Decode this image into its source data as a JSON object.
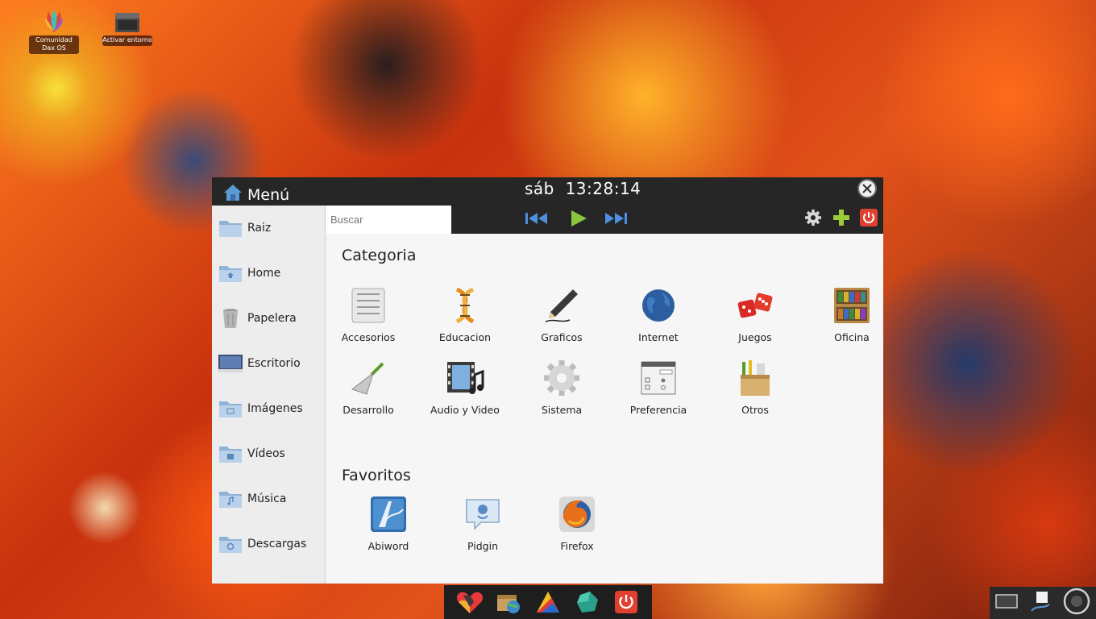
{
  "desktop": {
    "icons": [
      {
        "label": "Comunidad Dax OS",
        "icon": "dax-os-logo-icon"
      },
      {
        "label": "Activar entorno",
        "icon": "terminal-icon"
      }
    ]
  },
  "menu": {
    "title": "Menú",
    "clock": "sáb  13:28:14",
    "search_placeholder": "Buscar",
    "media": [
      "previous-track-icon",
      "play-icon",
      "next-track-icon"
    ],
    "tools": [
      "settings-gear-icon",
      "add-plus-icon",
      "power-icon"
    ],
    "sidebar": [
      {
        "label": "Raiz",
        "icon": "folder-icon"
      },
      {
        "label": "Home",
        "icon": "home-folder-icon"
      },
      {
        "label": "Papelera",
        "icon": "trash-icon"
      },
      {
        "label": "Escritorio",
        "icon": "desktop-icon"
      },
      {
        "label": "Imágenes",
        "icon": "pictures-folder-icon"
      },
      {
        "label": "Vídeos",
        "icon": "videos-folder-icon"
      },
      {
        "label": "Música",
        "icon": "music-folder-icon"
      },
      {
        "label": "Descargas",
        "icon": "downloads-folder-icon"
      }
    ],
    "categories_title": "Categoria",
    "categories": [
      {
        "label": "Accesorios",
        "icon": "accessories-icon"
      },
      {
        "label": "Educacion",
        "icon": "dna-icon"
      },
      {
        "label": "Graficos",
        "icon": "pencil-icon"
      },
      {
        "label": "Internet",
        "icon": "globe-icon"
      },
      {
        "label": "Juegos",
        "icon": "dice-icon"
      },
      {
        "label": "Oficina",
        "icon": "bookshelf-icon"
      },
      {
        "label": "Desarrollo",
        "icon": "trowel-icon"
      },
      {
        "label": "Audio y Video",
        "icon": "film-music-icon"
      },
      {
        "label": "Sistema",
        "icon": "system-gear-icon"
      },
      {
        "label": "Preferencia",
        "icon": "preferences-window-icon"
      },
      {
        "label": "Otros",
        "icon": "box-icon"
      }
    ],
    "favorites_title": "Favoritos",
    "favorites": [
      {
        "label": "Abiword",
        "icon": "abiword-icon"
      },
      {
        "label": "Pidgin",
        "icon": "pidgin-icon"
      },
      {
        "label": "Firefox",
        "icon": "firefox-icon"
      }
    ]
  },
  "taskbar": {
    "launchers": [
      "heart-logo-icon",
      "file-manager-icon",
      "media-player-icon",
      "gem-icon",
      "power-icon"
    ],
    "tray": [
      "window-icon",
      "note-icon",
      "speaker-icon"
    ]
  }
}
